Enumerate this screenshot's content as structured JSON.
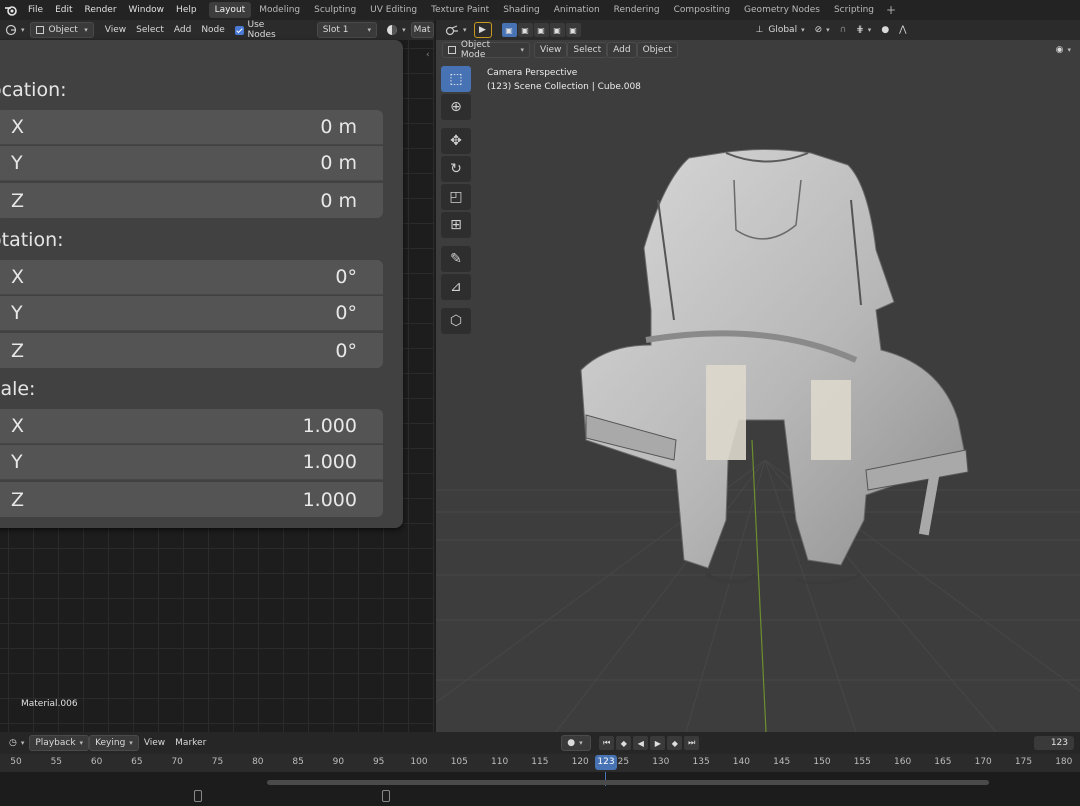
{
  "top_menu": {
    "items": [
      "File",
      "Edit",
      "Render",
      "Window",
      "Help"
    ],
    "workspaces": [
      "Layout",
      "Modeling",
      "Sculpting",
      "UV Editing",
      "Texture Paint",
      "Shading",
      "Animation",
      "Rendering",
      "Compositing",
      "Geometry Nodes",
      "Scripting"
    ],
    "active_workspace": "Layout"
  },
  "left_editor": {
    "header": {
      "object_mode": "Object",
      "view": "View",
      "select": "Select",
      "add": "Add",
      "node": "Node",
      "use_nodes": "Use Nodes",
      "slot": "Slot 1",
      "material_trunc": "Mat"
    },
    "transform": {
      "location_heading": "ocation:",
      "rotation_heading": "otation:",
      "scale_heading": "cale:",
      "location": [
        {
          "axis": "X",
          "value": "0 m"
        },
        {
          "axis": "Y",
          "value": "0 m"
        },
        {
          "axis": "Z",
          "value": "0 m"
        }
      ],
      "rotation": [
        {
          "axis": "X",
          "value": "0°"
        },
        {
          "axis": "Y",
          "value": "0°"
        },
        {
          "axis": "Z",
          "value": "0°"
        }
      ],
      "scale": [
        {
          "axis": "X",
          "value": "1.000"
        },
        {
          "axis": "Y",
          "value": "1.000"
        },
        {
          "axis": "Z",
          "value": "1.000"
        }
      ]
    },
    "material_label": "Material.006"
  },
  "viewport": {
    "header": {
      "transform_orientation": "Global"
    },
    "header2": {
      "mode": "Object Mode",
      "view": "View",
      "select": "Select",
      "add": "Add",
      "object": "Object"
    },
    "info_line1": "Camera Perspective",
    "info_line2": "(123) Scene Collection | Cube.008"
  },
  "timeline": {
    "playback": "Playback",
    "keying": "Keying",
    "view": "View",
    "marker": "Marker",
    "current_frame": "123",
    "frame_ticks": [
      "50",
      "55",
      "60",
      "65",
      "70",
      "75",
      "80",
      "85",
      "90",
      "95",
      "100",
      "105",
      "110",
      "115",
      "120",
      "125",
      "130",
      "135",
      "140",
      "145",
      "150",
      "155",
      "160",
      "165",
      "170",
      "175",
      "180"
    ]
  },
  "colors": {
    "accent": "#4772b3",
    "panel": "#424242",
    "field": "#545454",
    "grid_floor": "#3d3d3d",
    "mesh": "#c9c9c9"
  }
}
